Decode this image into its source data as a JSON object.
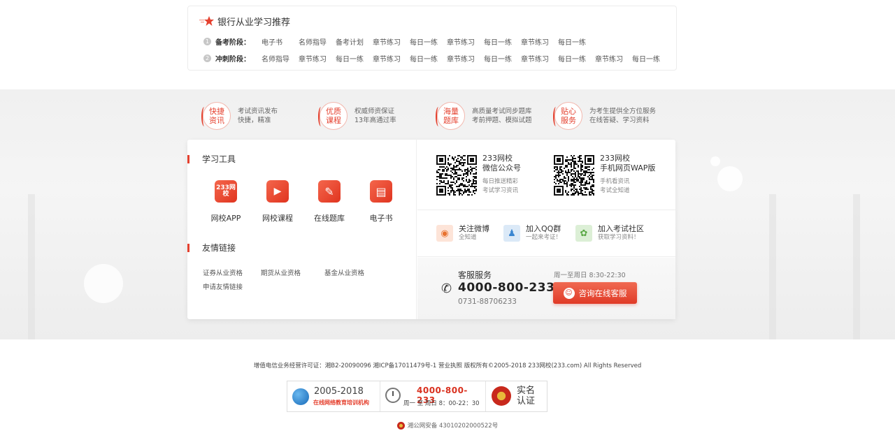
{
  "recommend": {
    "title": "银行从业学习推荐",
    "rows": [
      {
        "num": "1",
        "stage": "备考阶段：",
        "items": [
          "电子书",
          "名师指导",
          "备考计划",
          "章节练习",
          "每日一练",
          "章节练习",
          "每日一练",
          "章节练习",
          "每日一练"
        ]
      },
      {
        "num": "2",
        "stage": "冲刺阶段：",
        "items": [
          "名师指导",
          "章节练习",
          "每日一练",
          "章节练习",
          "每日一练",
          "章节练习",
          "每日一练",
          "章节练习",
          "每日一练",
          "章节练习",
          "每日一练"
        ]
      }
    ]
  },
  "features": [
    {
      "badge": "快捷资讯",
      "line1": "考试资讯发布",
      "line2": "快捷，精准"
    },
    {
      "badge": "优质课程",
      "line1": "权威师资保证",
      "line2": "13年高通过率"
    },
    {
      "badge": "海量题库",
      "line1": "高质量考试同步题库",
      "line2": "考前押题、模拟试题"
    },
    {
      "badge": "贴心服务",
      "line1": "为考生提供全方位服务",
      "line2": "在线答疑、学习资料"
    }
  ],
  "tools": {
    "title": "学习工具",
    "items": [
      {
        "label": "网校APP",
        "icon": "app-icon",
        "glyph": "233网校"
      },
      {
        "label": "网校课程",
        "icon": "video-icon",
        "glyph": "▶"
      },
      {
        "label": "在线题库",
        "icon": "pencil-icon",
        "glyph": "✎"
      },
      {
        "label": "电子书",
        "icon": "book-icon",
        "glyph": "▤"
      }
    ]
  },
  "links": {
    "title": "友情链接",
    "row1": [
      "证券从业资格",
      "期货从业资格",
      "基金从业资格"
    ],
    "row2": [
      "申请友情链接"
    ]
  },
  "qrcodes": [
    {
      "name": "233网校",
      "sub": "微信公众号",
      "d1": "每日推送精彩",
      "d2": "考试学习资讯"
    },
    {
      "name": "233网校",
      "sub": "手机网页WAP版",
      "d1": "手机看资讯",
      "d2": "考试全知道"
    }
  ],
  "social": [
    {
      "label": "关注微博",
      "sub": "全知道",
      "icon": "weibo-icon",
      "color": "#fde4d8",
      "glyph": "◉"
    },
    {
      "label": "加入QQ群",
      "sub": "一起来考证！",
      "icon": "qq-icon",
      "color": "#dbe9f7",
      "glyph": "♟"
    },
    {
      "label": "加入考试社区",
      "sub": "获取学习资料！",
      "icon": "community-icon",
      "color": "#dcefd6",
      "glyph": "✿"
    }
  ],
  "service": {
    "title": "客服服务",
    "phone": "4000-800-233",
    "sub": "0731-88706233",
    "hours": "周一至周日 8:30-22:30",
    "button": "咨询在线客服"
  },
  "footer": {
    "license": "增值电信业务经营许可证：湘B2-20090096  湘ICP备17011479号-1  营业执照   版权所有©2005-2018 233网校(233.com) All Rights Reserved",
    "badge1_year": "2005-2018",
    "badge1_sub": "在线网络教育培训机构",
    "badge2_tel": "4000-800-233",
    "badge2_hours": "周一 至 周日 8：00-22：30",
    "badge3_l1": "实名",
    "badge3_l2": "认证",
    "police": "湘公网安备  43010202000522号"
  },
  "colors": {
    "accent": "#e5412f"
  }
}
